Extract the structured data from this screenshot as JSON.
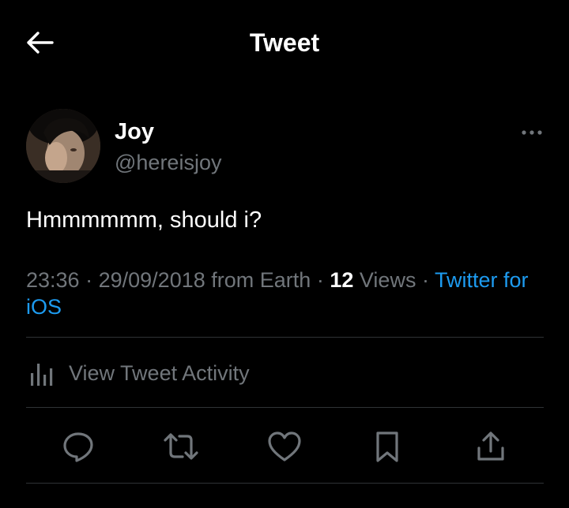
{
  "header": {
    "title": "Tweet",
    "back_icon": "arrow-left-icon"
  },
  "author": {
    "display_name": "Joy",
    "handle": "@hereisjoy",
    "more_icon": "more-horizontal-icon"
  },
  "tweet": {
    "text": "Hmmmmmm, should i?",
    "time": "23:36",
    "date": "29/09/2018",
    "location": "from Earth",
    "views_count": "12",
    "views_label": "Views",
    "source": "Twitter for iOS",
    "separator": "·"
  },
  "activity": {
    "label": "View Tweet Activity",
    "icon": "bar-chart-icon"
  },
  "actions": [
    {
      "name": "reply",
      "icon": "reply-icon"
    },
    {
      "name": "retweet",
      "icon": "retweet-icon"
    },
    {
      "name": "like",
      "icon": "heart-icon"
    },
    {
      "name": "bookmark",
      "icon": "bookmark-icon"
    },
    {
      "name": "share",
      "icon": "share-icon"
    }
  ],
  "colors": {
    "background": "#000000",
    "text_primary": "#ffffff",
    "text_secondary": "#71767b",
    "accent": "#1d9bf0",
    "divider": "#2f3336"
  }
}
